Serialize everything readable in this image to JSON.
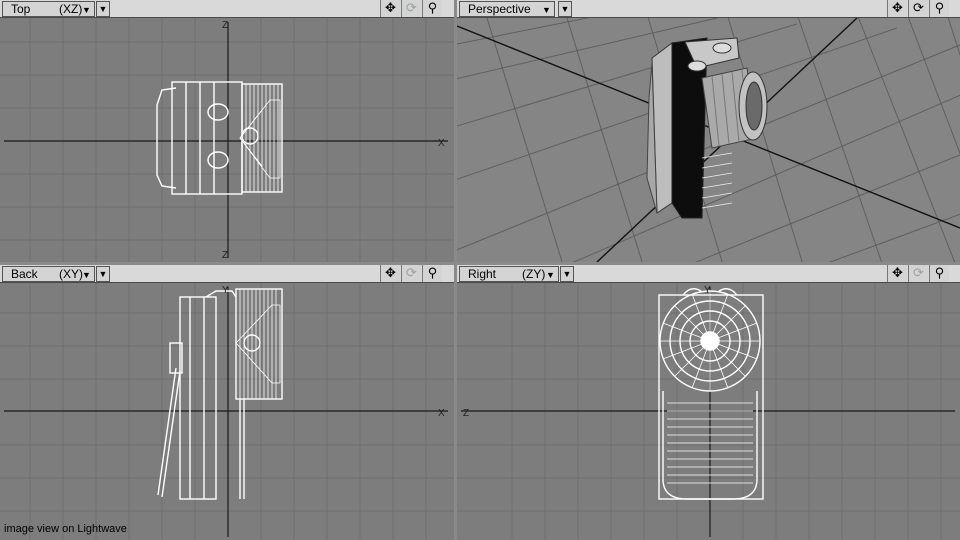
{
  "viewports": {
    "top": {
      "name": "Top",
      "axes": "(XZ)"
    },
    "persp": {
      "name": "Perspective",
      "axes": ""
    },
    "back": {
      "name": "Back",
      "axes": "(XY)"
    },
    "right": {
      "name": "Right",
      "axes": "(ZY)"
    }
  },
  "axis_letters": {
    "z": "Z",
    "x": "X",
    "y": "Y"
  },
  "icons": {
    "move": "move-icon",
    "rotate": "rotate-icon",
    "zoom": "zoom-icon",
    "dropdown": "dropdown-arrow-icon"
  },
  "caption": "image view on Lightwave",
  "colors": {
    "viewport_bg": "#7d7d7d",
    "grid": "#6f6f6f",
    "axis": "#1a1a1a",
    "wire": "#ffffff"
  }
}
